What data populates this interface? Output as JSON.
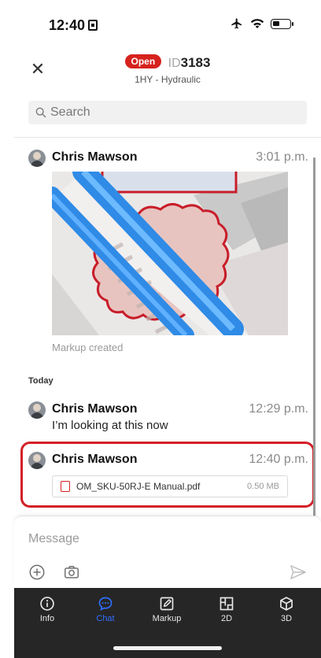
{
  "status_bar": {
    "time": "12:40"
  },
  "header": {
    "close_label": "✕",
    "status_badge": "Open",
    "id_prefix": "ID",
    "id_number": "3183",
    "subtitle": "1HY - Hydraulic"
  },
  "search": {
    "placeholder": "Search"
  },
  "messages": [
    {
      "author": "Chris Mawson",
      "time": "3:01 p.m.",
      "caption": "Markup created"
    },
    {
      "author": "Chris Mawson",
      "time": "12:29 p.m.",
      "text": "I’m looking at this now"
    },
    {
      "author": "Chris Mawson",
      "time": "12:40 p.m.",
      "attachment": {
        "name": "OM_SKU-50RJ-E Manual.pdf",
        "size": "0.50 MB"
      }
    }
  ],
  "section_today": "Today",
  "composer": {
    "placeholder": "Message"
  },
  "bottom_nav": [
    {
      "label": "Info",
      "icon": "info-icon"
    },
    {
      "label": "Chat",
      "icon": "chat-icon",
      "active": true
    },
    {
      "label": "Markup",
      "icon": "markup-icon"
    },
    {
      "label": "2D",
      "icon": "floorplan-icon"
    },
    {
      "label": "3D",
      "icon": "cube-icon"
    }
  ],
  "colors": {
    "accent": "#2f6fff",
    "open_badge": "#d6221d",
    "highlight": "#d32027",
    "nav_bg": "#262626"
  }
}
